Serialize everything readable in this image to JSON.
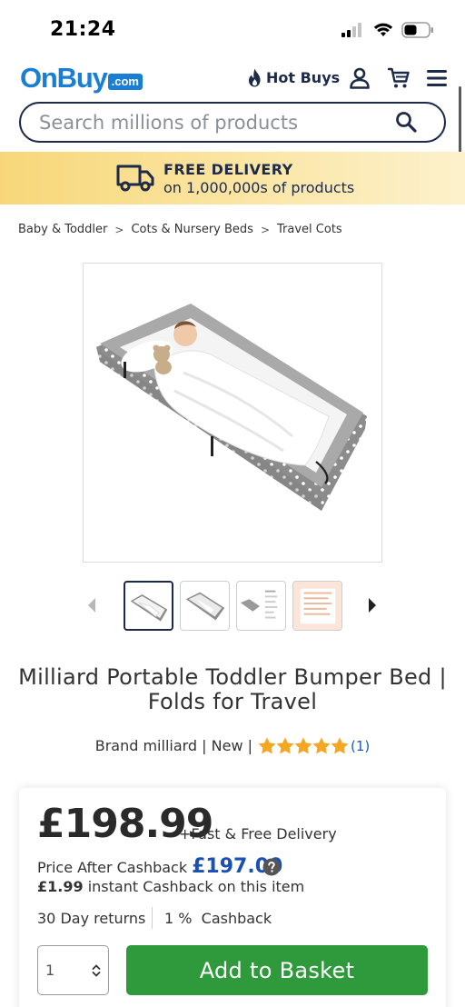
{
  "status_bar": {
    "time": "21:24"
  },
  "header": {
    "logo_text": "OnBuy",
    "logo_suffix": ".com",
    "hot_buys_label": "Hot Buys"
  },
  "search": {
    "placeholder": "Search millions of products",
    "value": ""
  },
  "banner": {
    "title": "FREE DELIVERY",
    "subtitle": "on 1,000,000s of products"
  },
  "breadcrumb": [
    {
      "label": "Baby & Toddler"
    },
    {
      "label": "Cots & Nursery Beds"
    },
    {
      "label": "Travel Cots"
    }
  ],
  "product": {
    "title": "Milliard Portable Toddler Bumper Bed | Folds for Travel",
    "brand_text": "Brand milliard | New |",
    "rating": 5,
    "rating_max": 5,
    "review_count": "(1)",
    "thumbnails": 4,
    "active_thumbnail": 1
  },
  "pricing": {
    "price": "£198.99",
    "delivery_note": "+Fast & Free Delivery",
    "after_cashback_label": "Price After Cashback",
    "after_cashback_value": "£197.00",
    "instant_amount": "£1.99",
    "instant_text": "instant Cashback on this item",
    "returns": "30 Day returns",
    "cashback_percent": "1 %  Cashback",
    "quantity": "1",
    "add_button": "Add to Basket"
  },
  "colors": {
    "brand_blue": "#1a7fd4",
    "navy": "#1d2a4a",
    "banner_yellow": "#f7d779",
    "add_green": "#2e9a3b",
    "cashback_blue": "#1a4fb3",
    "star_orange": "#f5a623"
  },
  "icons": [
    "signal-icon",
    "wifi-icon",
    "battery-icon",
    "flame-icon",
    "user-icon",
    "cart-icon",
    "menu-icon",
    "search-icon",
    "truck-icon",
    "chevron-left-icon",
    "chevron-right-icon",
    "star-icon",
    "help-icon",
    "stepper-arrows-icon"
  ]
}
